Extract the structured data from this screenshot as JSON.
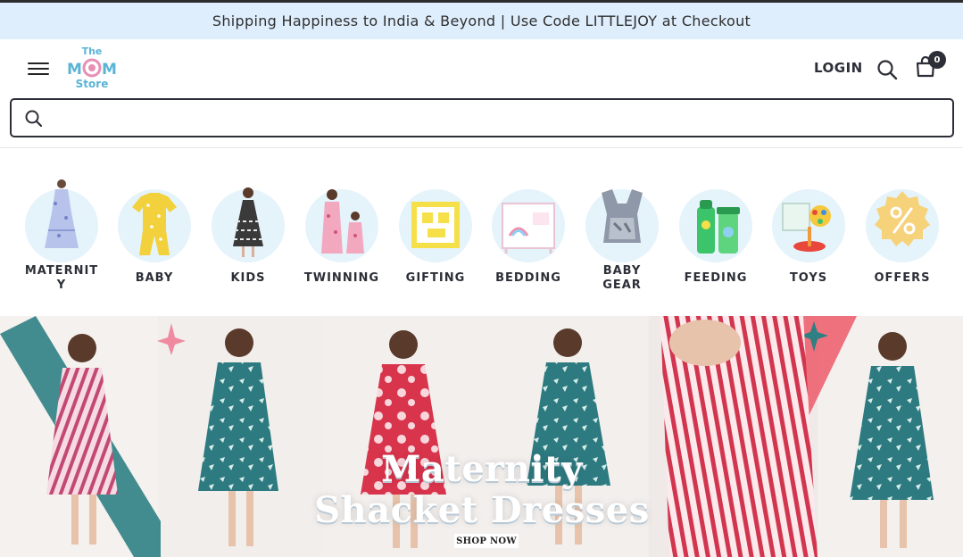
{
  "announcement": {
    "text": "Shipping Happiness to India & Beyond | Use Code LITTLEJOY at Checkout"
  },
  "header": {
    "logo": {
      "line1": "The",
      "line2": "MOM",
      "line3": "Store"
    },
    "login_label": "LOGIN",
    "cart_count": "0",
    "menu_icon": "hamburger-icon",
    "search_icon": "search-icon",
    "cart_icon": "shopping-bag-icon"
  },
  "search": {
    "placeholder": "",
    "value": ""
  },
  "categories": [
    {
      "label": "MATERNITY"
    },
    {
      "label": "BABY"
    },
    {
      "label": "KIDS"
    },
    {
      "label": "TWINNING"
    },
    {
      "label": "GIFTING"
    },
    {
      "label": "BEDDING"
    },
    {
      "label": "BABY GEAR"
    },
    {
      "label": "FEEDING"
    },
    {
      "label": "TOYS"
    },
    {
      "label": "OFFERS"
    }
  ],
  "banner": {
    "title_line1": "Maternity",
    "title_line2": "Shacket Dresses",
    "cta": "SHOP NOW"
  },
  "colors": {
    "announcement_bg": "#dfeefd",
    "text_dark": "#2d2f38",
    "logo_blue": "#5ab4d6",
    "logo_pink": "#e88fb4",
    "category_circle": "#e5f3fb"
  }
}
